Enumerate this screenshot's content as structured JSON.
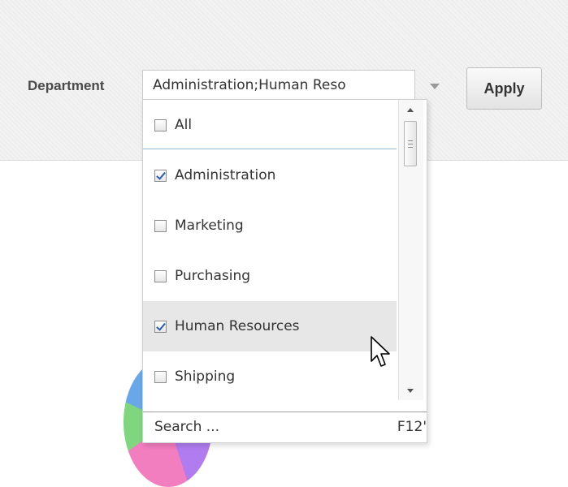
{
  "filter": {
    "label": "Department",
    "selected_value": "Administration;Human Reso",
    "apply_label": "Apply"
  },
  "dropdown": {
    "items": [
      {
        "label": "All",
        "checked": false
      },
      {
        "label": "Administration",
        "checked": true
      },
      {
        "label": "Marketing",
        "checked": false
      },
      {
        "label": "Purchasing",
        "checked": false
      },
      {
        "label": "Human Resources",
        "checked": true
      },
      {
        "label": "Shipping",
        "checked": false
      }
    ],
    "search_label": "Search ...",
    "search_shortcut": "F12'"
  },
  "colors": {
    "checkmark": "#2b5fb4",
    "hover_row": "#e7e7e7",
    "separator": "#8fb9d4"
  }
}
